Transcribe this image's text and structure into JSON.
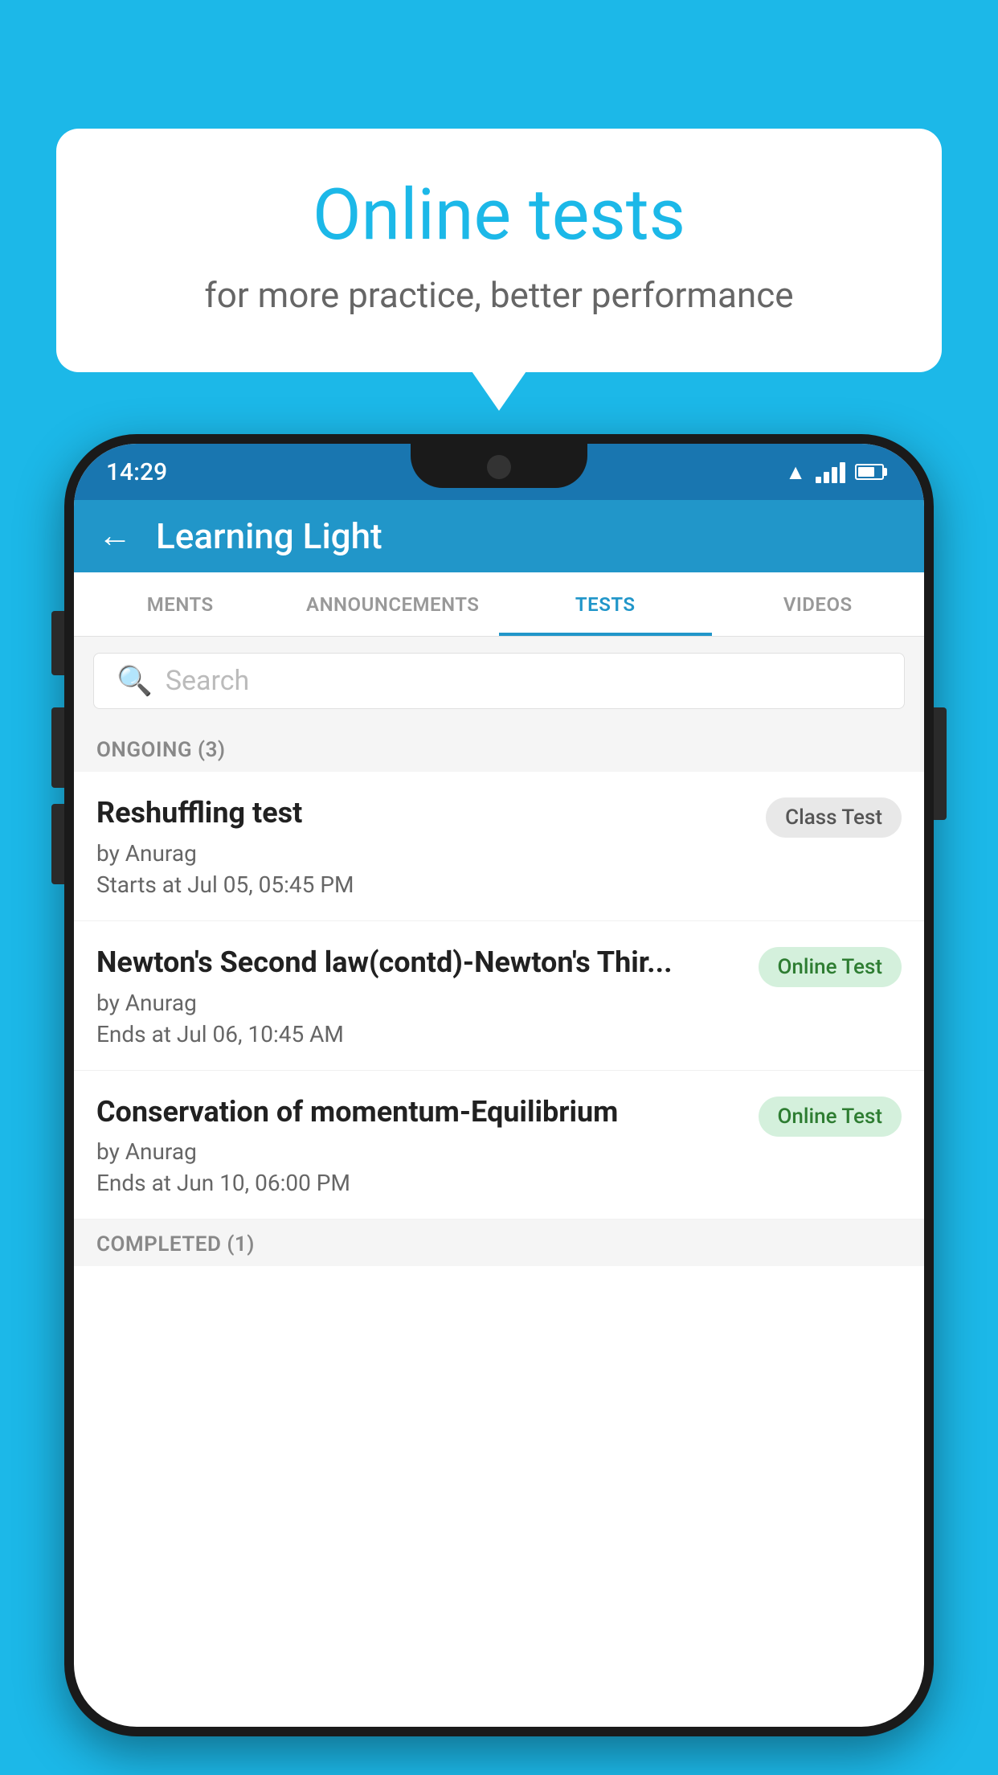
{
  "background_color": "#1cb8e8",
  "speech_bubble": {
    "title": "Online tests",
    "subtitle": "for more practice, better performance"
  },
  "phone": {
    "status_bar": {
      "time": "14:29"
    },
    "app_header": {
      "back_label": "←",
      "title": "Learning Light"
    },
    "tabs": [
      {
        "id": "ments",
        "label": "MENTS",
        "active": false
      },
      {
        "id": "announcements",
        "label": "ANNOUNCEMENTS",
        "active": false
      },
      {
        "id": "tests",
        "label": "TESTS",
        "active": true
      },
      {
        "id": "videos",
        "label": "VIDEOS",
        "active": false
      }
    ],
    "search": {
      "placeholder": "Search"
    },
    "ongoing_section": {
      "label": "ONGOING (3)",
      "tests": [
        {
          "name": "Reshuffling test",
          "author": "by Anurag",
          "date": "Starts at  Jul 05, 05:45 PM",
          "badge": "Class Test",
          "badge_type": "class"
        },
        {
          "name": "Newton's Second law(contd)-Newton's Thir...",
          "author": "by Anurag",
          "date": "Ends at  Jul 06, 10:45 AM",
          "badge": "Online Test",
          "badge_type": "online"
        },
        {
          "name": "Conservation of momentum-Equilibrium",
          "author": "by Anurag",
          "date": "Ends at  Jun 10, 06:00 PM",
          "badge": "Online Test",
          "badge_type": "online"
        }
      ]
    },
    "completed_section": {
      "label": "COMPLETED (1)"
    }
  }
}
